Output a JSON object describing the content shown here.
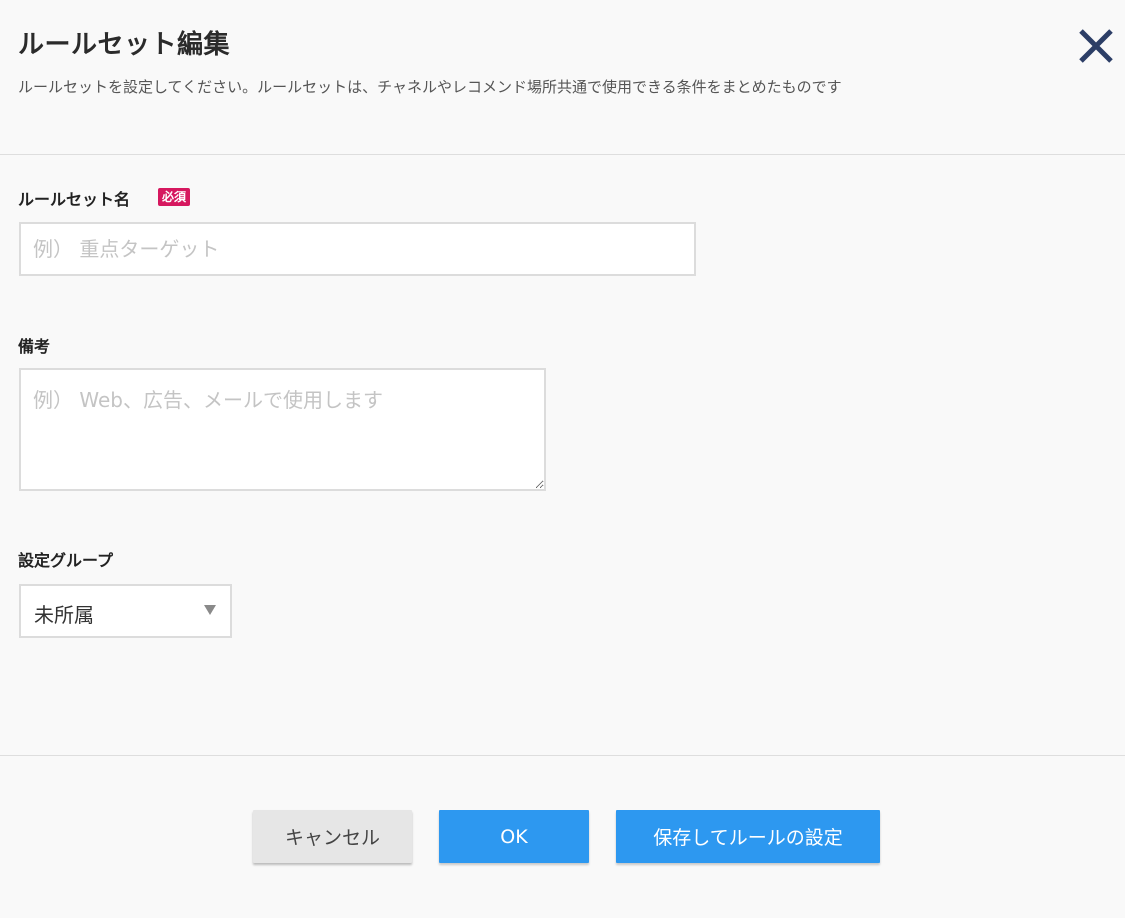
{
  "dialog": {
    "title": "ルールセット編集",
    "subtitle": "ルールセットを設定してください。ルールセットは、チャネルやレコメンド場所共通で使用できる条件をまとめたものです",
    "close_icon": "close-icon"
  },
  "form": {
    "ruleset_name": {
      "label": "ルールセット名",
      "required_badge": "必須",
      "value": "",
      "placeholder": "例） 重点ターゲット"
    },
    "notes": {
      "label": "備考",
      "value": "",
      "placeholder": "例） Web、広告、メールで使用します"
    },
    "group": {
      "label": "設定グループ",
      "selected": "未所属"
    }
  },
  "footer": {
    "cancel_label": "キャンセル",
    "ok_label": "OK",
    "save_label": "保存してルールの設定"
  },
  "colors": {
    "primary": "#2d98f0",
    "required": "#d6185f",
    "close_icon": "#2c3e66",
    "background": "#f9f9f9"
  }
}
